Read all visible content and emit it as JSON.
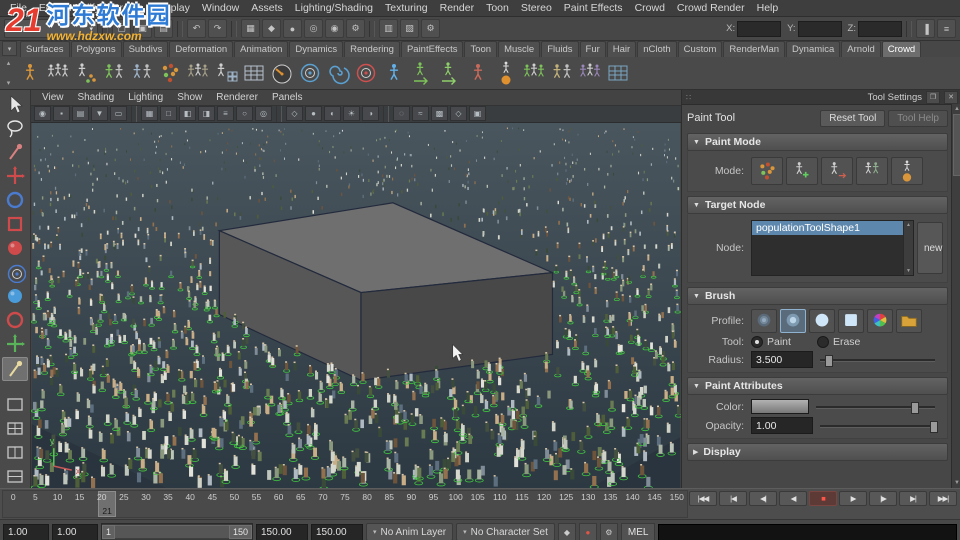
{
  "colors": {
    "accent": "#5d87ad",
    "select_green": "#3fc63f",
    "record_red": "#e04840",
    "viewport_top": "#4a565e",
    "viewport_bottom": "#2d3942",
    "cube_top": "#6f6f6f",
    "cube_left": "#575757",
    "cube_right": "#484848",
    "cube_edge": "#222a3c"
  },
  "watermark": {
    "badge": "21",
    "title": "河东软件园",
    "subtitle": "www.hdzxw.com"
  },
  "menubar": {
    "items": [
      "File",
      "Edit",
      "Modify",
      "Create",
      "Display",
      "Window",
      "Assets",
      "Lighting/Shading",
      "Texturing",
      "Render",
      "Toon",
      "Stereo",
      "Paint Effects",
      "Crowd",
      "Crowd Render",
      "Help"
    ]
  },
  "statusline": {
    "icons": [
      {
        "name": "new-scene-icon",
        "glyph": "▢"
      },
      {
        "name": "open-scene-icon",
        "glyph": "▣"
      },
      {
        "name": "save-scene-icon",
        "glyph": "▤"
      },
      {
        "name": "undo-icon",
        "glyph": "↶"
      },
      {
        "name": "redo-icon",
        "glyph": "↷"
      },
      {
        "name": "snap-grid-icon",
        "glyph": "▦"
      },
      {
        "name": "snap-curve-icon",
        "glyph": "◆"
      },
      {
        "name": "snap-point-icon",
        "glyph": "●"
      },
      {
        "name": "snap-view-plane-icon",
        "glyph": "◎"
      },
      {
        "name": "make-live-icon",
        "glyph": "◉"
      },
      {
        "name": "construction-history-icon",
        "glyph": "⚙"
      },
      {
        "name": "render-current-frame-icon",
        "glyph": "▥"
      },
      {
        "name": "ipr-render-icon",
        "glyph": "▨"
      },
      {
        "name": "render-settings-icon",
        "glyph": "⚙"
      }
    ],
    "coord_fields": [
      {
        "label": "X:"
      },
      {
        "label": "Y:"
      },
      {
        "label": "Z:"
      }
    ]
  },
  "shelf": {
    "tabs": [
      "Surfaces",
      "Polygons",
      "Subdivs",
      "Deformation",
      "Animation",
      "Dynamics",
      "Rendering",
      "PaintEffects",
      "Toon",
      "Muscle",
      "Fluids",
      "Fur",
      "Hair",
      "nCloth",
      "Custom",
      "RenderMan",
      "Dynamica",
      "Arnold",
      "Crowd"
    ],
    "active_tab": "Crowd",
    "icons": [
      {
        "name": "crowd-manager-icon",
        "type": "people1",
        "color": "#d9963a"
      },
      {
        "name": "population-tool-icon",
        "type": "people3",
        "color": "#cfcfcf"
      },
      {
        "name": "paint-population-icon",
        "type": "people-dots",
        "color": "#d9963a"
      },
      {
        "name": "crowd-group-icon",
        "type": "people2",
        "color": "#7ec35a"
      },
      {
        "name": "entity-types-icon",
        "type": "people2",
        "color": "#9fb3c8"
      },
      {
        "name": "scatter-points-icon",
        "type": "dots",
        "color": "#d9963a"
      },
      {
        "name": "crowd-units-icon",
        "type": "people3",
        "color": "#a8a18a"
      },
      {
        "name": "formation-grid-icon",
        "type": "people-grid",
        "color": "#cfcfcf"
      },
      {
        "name": "attribute-table-icon",
        "type": "grid",
        "color": "#b5c2cc"
      },
      {
        "name": "speed-gauge-icon",
        "type": "gauge",
        "color": "#e0912f"
      },
      {
        "name": "orient-behavior-icon",
        "type": "target",
        "color": "#5aa0d0"
      },
      {
        "name": "vortex-field-icon",
        "type": "spiral",
        "color": "#5aa0d0"
      },
      {
        "name": "goal-behavior-icon",
        "type": "target",
        "color": "#d05050"
      },
      {
        "name": "follow-path-icon",
        "type": "people1",
        "color": "#62b0e8"
      },
      {
        "name": "run-behavior-icon",
        "type": "runner",
        "color": "#7ec35a"
      },
      {
        "name": "walk-behavior-icon",
        "type": "runner",
        "color": "#8fd06a"
      },
      {
        "name": "stop-behavior-icon",
        "type": "people1",
        "color": "#c86a5a"
      },
      {
        "name": "locomotion-icon",
        "type": "ball-figure",
        "color": "#e0912f"
      },
      {
        "name": "crowd-sim-icon",
        "type": "people3",
        "color": "#7ec35a"
      },
      {
        "name": "terrain-adapt-icon",
        "type": "people2",
        "color": "#c2b27a"
      },
      {
        "name": "crowd-render-icon",
        "type": "people3",
        "color": "#9a86b8"
      },
      {
        "name": "crowd-cache-icon",
        "type": "grid",
        "color": "#7aa7c2"
      }
    ]
  },
  "toolbox": {
    "tools": [
      {
        "name": "select-tool",
        "type": "arrow",
        "color": "#e6e6e6"
      },
      {
        "name": "lasso-select-tool",
        "type": "lasso",
        "color": "#e6e6e6"
      },
      {
        "name": "paint-select-tool",
        "type": "brush",
        "color": "#d98080"
      },
      {
        "name": "move-tool",
        "type": "cross",
        "color": "#cf4a4a"
      },
      {
        "name": "rotate-tool",
        "type": "ring",
        "color": "#4a7bcf"
      },
      {
        "name": "scale-tool",
        "type": "box",
        "color": "#cf4a4a"
      },
      {
        "name": "soft-mod-tool",
        "type": "sphere",
        "color": "#cf4a4a"
      },
      {
        "name": "show-manipulator-tool",
        "type": "target",
        "color": "#4a7bcf"
      },
      {
        "name": "crowd-place-tool",
        "type": "sphere",
        "color": "#4a9bd9"
      },
      {
        "name": "crowd-orient-tool",
        "type": "ring",
        "color": "#cf4a4a"
      },
      {
        "name": "jack-tool",
        "type": "cross",
        "color": "#59b359"
      },
      {
        "name": "paint-tool",
        "type": "brush",
        "color": "#e8d9a0",
        "current": true
      }
    ],
    "layouts": [
      {
        "name": "layout-single-pane",
        "type": "pane1"
      },
      {
        "name": "layout-four-pane",
        "type": "pane4"
      },
      {
        "name": "layout-two-pane-vertical",
        "type": "pane2v"
      },
      {
        "name": "layout-two-pane-horizontal",
        "type": "pane2h"
      }
    ]
  },
  "panel_menu": {
    "items": [
      "View",
      "Shading",
      "Lighting",
      "Show",
      "Renderer",
      "Panels"
    ]
  },
  "panel_toolbar": {
    "icons": [
      {
        "name": "select-camera-icon",
        "glyph": "◉"
      },
      {
        "name": "lock-camera-icon",
        "glyph": "▪"
      },
      {
        "name": "camera-attributes-icon",
        "glyph": "▤"
      },
      {
        "name": "bookmarks-icon",
        "glyph": "▼"
      },
      {
        "name": "image-plane-icon",
        "glyph": "▭"
      },
      {
        "name": "grid-icon",
        "glyph": "▦"
      },
      {
        "name": "film-gate-icon",
        "glyph": "□"
      },
      {
        "name": "resolution-gate-icon",
        "glyph": "◧"
      },
      {
        "name": "gate-mask-icon",
        "glyph": "◨"
      },
      {
        "name": "field-chart-icon",
        "glyph": "≡"
      },
      {
        "name": "safe-action-icon",
        "glyph": "○"
      },
      {
        "name": "safe-title-icon",
        "glyph": "◎"
      },
      {
        "name": "wireframe-icon",
        "glyph": "◇"
      },
      {
        "name": "smooth-shade-icon",
        "glyph": "●"
      },
      {
        "name": "textured-icon",
        "glyph": "◐"
      },
      {
        "name": "use-lights-icon",
        "glyph": "☀"
      },
      {
        "name": "shadows-icon",
        "glyph": "◑"
      },
      {
        "name": "occlusion-icon",
        "glyph": "◌"
      },
      {
        "name": "motion-blur-icon",
        "glyph": "≈"
      },
      {
        "name": "multisample-icon",
        "glyph": "▩"
      },
      {
        "name": "xray-icon",
        "glyph": "◇"
      },
      {
        "name": "isolate-select-icon",
        "glyph": "▣"
      }
    ]
  },
  "tool_settings": {
    "title": "Tool Settings",
    "tool_name": "Paint Tool",
    "reset_label": "Reset Tool",
    "help_label": "Tool Help",
    "paint_mode": {
      "title": "Paint Mode",
      "mode_label": "Mode:",
      "modes": [
        {
          "name": "mode-add-icon",
          "type": "dots"
        },
        {
          "name": "mode-place-icon",
          "type": "people-green"
        },
        {
          "name": "mode-move-icon",
          "type": "people-arrows"
        },
        {
          "name": "mode-replace-icon",
          "type": "people-pair"
        },
        {
          "name": "mode-locomotion-icon",
          "type": "ball-figure"
        }
      ]
    },
    "target_node": {
      "title": "Target Node",
      "node_label": "Node:",
      "node_value": "populationToolShape1",
      "new_label": "new"
    },
    "brush": {
      "title": "Brush",
      "profile_label": "Profile:",
      "tool_label": "Tool:",
      "paint_label": "Paint",
      "erase_label": "Erase",
      "radius_label": "Radius:",
      "radius_value": "3.500",
      "profiles": [
        {
          "name": "profile-gaussian-icon",
          "type": "gaussian"
        },
        {
          "name": "profile-soft-icon",
          "type": "soft",
          "selected": true
        },
        {
          "name": "profile-solid-icon",
          "type": "solid"
        },
        {
          "name": "profile-square-icon",
          "type": "square"
        },
        {
          "name": "profile-color-wheel-icon",
          "type": "wheel"
        },
        {
          "name": "browse-stamps-icon",
          "type": "folder"
        }
      ]
    },
    "paint_attributes": {
      "title": "Paint Attributes",
      "color_label": "Color:",
      "opacity_label": "Opacity:",
      "opacity_value": "1.00"
    },
    "display": {
      "title": "Display"
    }
  },
  "timeline": {
    "labels": [
      "0",
      "5",
      "10",
      "15",
      "20",
      "25",
      "30",
      "35",
      "40",
      "45",
      "50",
      "55",
      "60",
      "65",
      "70",
      "75",
      "80",
      "85",
      "90",
      "95",
      "100",
      "105",
      "110",
      "115",
      "120",
      "125",
      "130",
      "135",
      "140",
      "145",
      "150"
    ],
    "range_min": 0,
    "range_max": 150,
    "current_frame": "21"
  },
  "transport": {
    "buttons": [
      {
        "name": "go-to-start-button",
        "glyph": "|◀◀"
      },
      {
        "name": "step-back-frame-button",
        "glyph": "|◀"
      },
      {
        "name": "step-back-key-button",
        "glyph": "◀|"
      },
      {
        "name": "play-backwards-button",
        "glyph": "◀"
      },
      {
        "name": "record-button",
        "glyph": "■",
        "red": true
      },
      {
        "name": "play-forward-button",
        "glyph": "▶"
      },
      {
        "name": "step-forward-key-button",
        "glyph": "|▶"
      },
      {
        "name": "step-forward-frame-button",
        "glyph": "▶|"
      },
      {
        "name": "go-to-end-button",
        "glyph": "▶▶|"
      }
    ]
  },
  "range_bar": {
    "anim_start": "1.00",
    "playback_start": "1.00",
    "range_start": "1",
    "range_end": "150",
    "playback_end": "150.00",
    "anim_end": "150.00"
  },
  "bottom": {
    "anim_layer_label": "No Anim Layer",
    "character_set_label": "No Character Set",
    "mel_label": "MEL",
    "icons": [
      {
        "name": "anim-key-icon",
        "glyph": "◆"
      },
      {
        "name": "auto-keyframe-icon",
        "glyph": "●",
        "red": true
      },
      {
        "name": "anim-prefs-icon",
        "glyph": "⚙"
      }
    ]
  },
  "viewport": {
    "axis_x_label": "x",
    "axis_y_label": "y"
  }
}
